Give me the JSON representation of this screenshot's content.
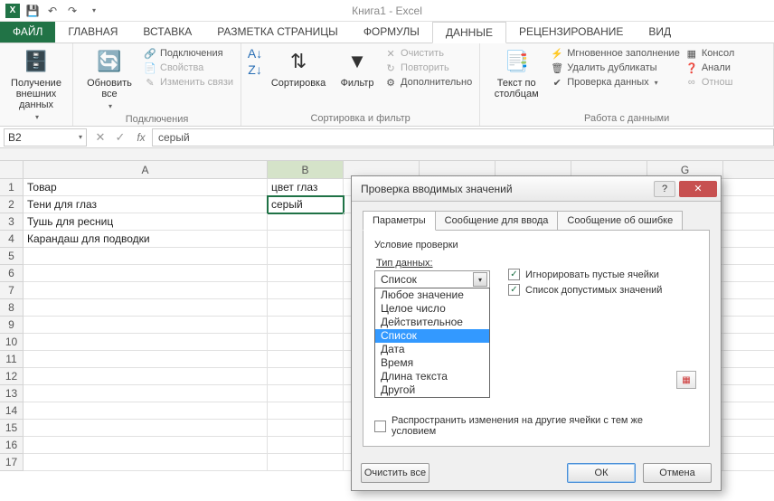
{
  "app_title": "Книга1 - Excel",
  "tabs": [
    "ФАЙЛ",
    "ГЛАВНАЯ",
    "ВСТАВКА",
    "РАЗМЕТКА СТРАНИЦЫ",
    "ФОРМУЛЫ",
    "ДАННЫЕ",
    "РЕЦЕНЗИРОВАНИЕ",
    "ВИД"
  ],
  "ribbon": {
    "group_connections_label": "Подключения",
    "group_sort_label": "Сортировка и фильтр",
    "group_datatools_label": "Работа с данными",
    "get_external": "Получение внешних данных",
    "refresh_all": "Обновить все",
    "connections": "Подключения",
    "properties": "Свойства",
    "edit_links": "Изменить связи",
    "sort": "Сортировка",
    "filter": "Фильтр",
    "clear": "Очистить",
    "reapply": "Повторить",
    "advanced": "Дополнительно",
    "text_to_columns": "Текст по столбцам",
    "flash_fill": "Мгновенное заполнение",
    "remove_dupes": "Удалить дубликаты",
    "data_validation": "Проверка данных",
    "consolidate": "Консол",
    "whatif": "Анали",
    "relations": "Отнош"
  },
  "name_box": "B2",
  "formula_value": "серый",
  "columns": [
    "A",
    "B",
    "",
    "",
    "",
    "",
    "G"
  ],
  "rows": [
    "1",
    "2",
    "3",
    "4",
    "5",
    "6",
    "7",
    "8",
    "9",
    "10",
    "11",
    "12",
    "13",
    "14",
    "15",
    "16",
    "17"
  ],
  "cells": {
    "A1": "Товар",
    "B1": "цвет глаз",
    "A2": "Тени для глаз",
    "B2": "серый",
    "A3": "Тушь для ресниц",
    "A4": "Карандаш для подводки"
  },
  "dialog": {
    "title": "Проверка вводимых значений",
    "tabs": [
      "Параметры",
      "Сообщение для ввода",
      "Сообщение об ошибке"
    ],
    "section_label": "Условие проверки",
    "type_label": "Тип данных:",
    "type_value": "Список",
    "type_options": [
      "Любое значение",
      "Целое число",
      "Действительное",
      "Список",
      "Дата",
      "Время",
      "Длина текста",
      "Другой"
    ],
    "ignore_blank": "Игнорировать пустые ячейки",
    "in_cell_dropdown": "Список допустимых значений",
    "apply_changes": "Распространить изменения на другие ячейки с тем же условием",
    "clear_all": "Очистить все",
    "ok": "ОК",
    "cancel": "Отмена"
  }
}
